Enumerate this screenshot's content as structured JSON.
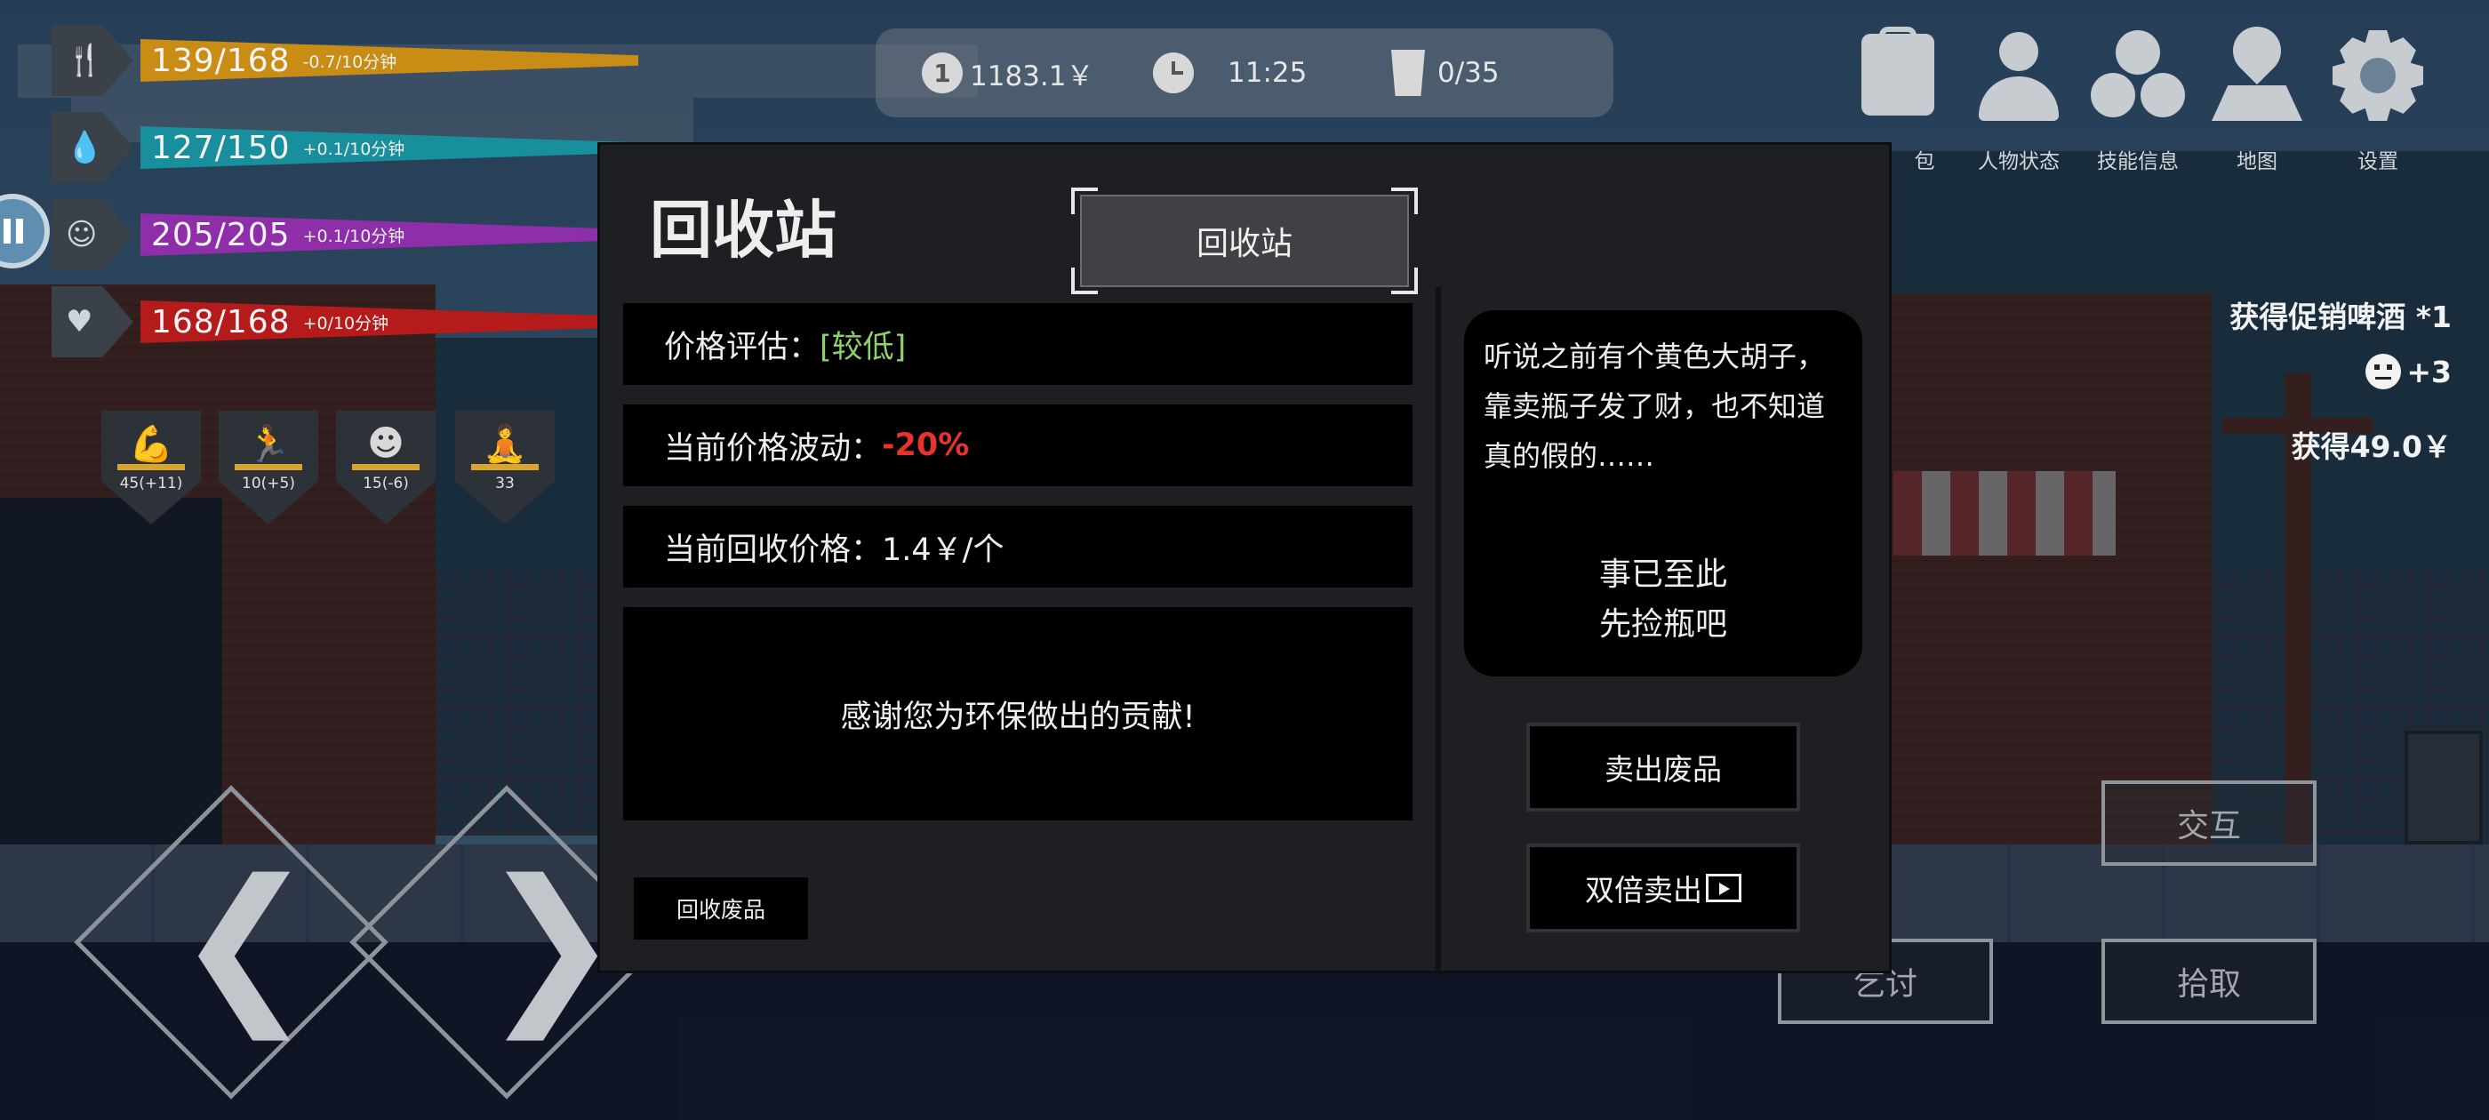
{
  "stats": [
    {
      "value": "139/168",
      "rate": "-0.7/10分钟",
      "color": "#c98c14",
      "icon": "fork-knife-icon",
      "glyph": "🍴"
    },
    {
      "value": "127/150",
      "rate": "+0.1/10分钟",
      "color": "#178f9c",
      "icon": "water-drop-icon",
      "glyph": "💧"
    },
    {
      "value": "205/205",
      "rate": "+0.1/10分钟",
      "color": "#8e2ea8",
      "icon": "face-icon",
      "glyph": "☺"
    },
    {
      "value": "168/168",
      "rate": "+0/10分钟",
      "color": "#b51b1b",
      "icon": "heartbeat-icon",
      "glyph": "♥"
    }
  ],
  "hud": {
    "money": "1183.1￥",
    "time": "11:25",
    "bin": "0/35",
    "coin_glyph": "1"
  },
  "menu": [
    {
      "label": "包",
      "icon": "backpack-icon"
    },
    {
      "label": "人物状态",
      "icon": "person-icon"
    },
    {
      "label": "技能信息",
      "icon": "skill-icon"
    },
    {
      "label": "地图",
      "icon": "map-icon"
    },
    {
      "label": "设置",
      "icon": "gear-icon"
    }
  ],
  "attributes": [
    {
      "value": "45(+11)",
      "icon": "muscle-icon",
      "glyph": "💪"
    },
    {
      "value": "10(+5)",
      "icon": "running-icon",
      "glyph": "🏃"
    },
    {
      "value": "15(-6)",
      "icon": "head-icon",
      "glyph": "☻"
    },
    {
      "value": "33",
      "icon": "meditate-icon",
      "glyph": "🧘"
    }
  ],
  "notifications": {
    "item": "获得促销啤酒 *1",
    "mood": "+3",
    "money": "获得49.0￥"
  },
  "actions": {
    "interact": "交互",
    "beg": "乞讨",
    "pickup": "拾取"
  },
  "modal": {
    "title": "回收站",
    "tab": "回收站",
    "price_eval_label": "价格评估：",
    "price_eval_value": "[较低]",
    "price_eval_color": "#8fd16a",
    "fluct_label": "当前价格波动：",
    "fluct_value": "-20%",
    "fluct_color": "#e8322d",
    "price": "当前回收价格：1.4￥/个",
    "thanks": "感谢您为环保做出的贡献!",
    "collect": "回收废品",
    "story": "听说之前有个黄色大胡子，靠卖瓶子发了财，也不知道真的假的……",
    "story_end_1": "事已至此",
    "story_end_2": "先捡瓶吧",
    "sell": "卖出废品",
    "sell_double": "双倍卖出"
  }
}
